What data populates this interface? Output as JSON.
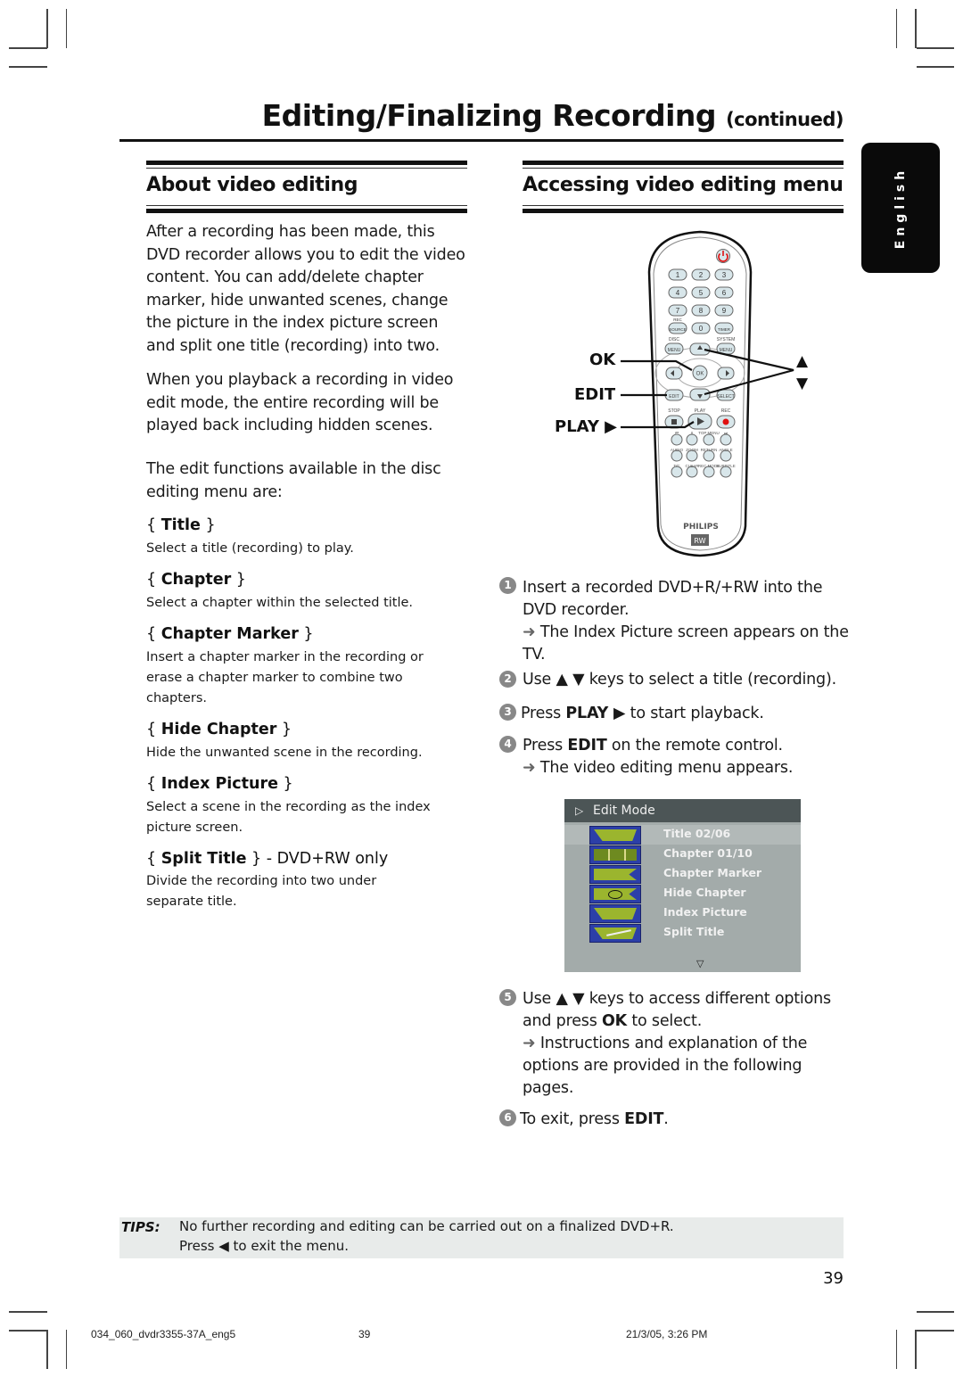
{
  "header": {
    "title": "Editing/Finalizing Recording",
    "title_suffix": "(continued)"
  },
  "language_tab": "English",
  "left_section": {
    "heading": "About video editing",
    "paragraphs": [
      "After a recording has been made, this DVD recorder allows you to edit the video content. You can add/delete chapter marker, hide unwanted scenes, change the picture in the index picture screen and split one title (recording) into two.",
      "When you playback a recording in video edit mode, the entire recording will be played back including hidden scenes.",
      "The edit functions available in the disc editing menu are:"
    ],
    "options": [
      {
        "name": "Title",
        "suffix": "",
        "description": "Select a title (recording) to play."
      },
      {
        "name": "Chapter",
        "suffix": "",
        "description": "Select a chapter within the selected title."
      },
      {
        "name": "Chapter Marker",
        "suffix": "",
        "description": "Insert a chapter marker in the recording or erase a chapter marker to combine two chapters."
      },
      {
        "name": "Hide Chapter",
        "suffix": "",
        "description": "Hide the unwanted scene in the recording."
      },
      {
        "name": "Index Picture",
        "suffix": "",
        "description": "Select a scene in the recording as the index picture screen."
      },
      {
        "name": "Split Title",
        "suffix": " - DVD+RW only",
        "description": "Divide the recording into two under separate title."
      }
    ]
  },
  "right_section": {
    "heading": "Accessing video editing menu",
    "remote": {
      "labels": {
        "ok": "OK",
        "edit": "EDIT",
        "play": "PLAY ▶",
        "up": "▲",
        "down": "▼"
      },
      "brand": "PHILIPS",
      "logo": "RW",
      "keys": {
        "digits": [
          "1",
          "2",
          "3",
          "4",
          "5",
          "6",
          "7",
          "8",
          "9",
          "0"
        ],
        "rec_source": "SOURCE",
        "timer": "TIMER",
        "rec_label": "REC",
        "disc_menu_label": "DISC",
        "menu": "MENU",
        "system_label": "SYSTEM",
        "ok": "OK",
        "edit": "EDIT",
        "select": "SELECT",
        "stop": "STOP",
        "play": "PLAY",
        "rec": "REC",
        "row1": [
          "⏮",
          "⏸",
          "TOP MENU",
          "⏭"
        ],
        "row2": [
          "AUDIO",
          "ZOOM",
          "RETURN",
          "ANGLE"
        ],
        "row3": [
          "T/C",
          "CLEAR",
          "REC MODE",
          "SUBTITLE"
        ]
      }
    },
    "steps": [
      {
        "n": "1",
        "text": "Insert a recorded DVD+R/+RW into the DVD recorder.",
        "result": "The Index Picture screen appears on the TV."
      },
      {
        "n": "2",
        "pre": "Use ▲ ▼ keys to select a title (recording).",
        "text": "Use ▲ ▼ keys to select a title (recording)."
      },
      {
        "n": "3",
        "pre": "Press ",
        "bold": "PLAY ▶",
        "post": " to start playback."
      },
      {
        "n": "4",
        "pre": "Press ",
        "bold": "EDIT",
        "post": " on the remote control.",
        "result": "The video editing menu appears."
      },
      {
        "n": "5",
        "pre": "Use ▲ ▼ keys to access different options and press ",
        "bold": "OK",
        "post": " to select.",
        "result": "Instructions and explanation of the options are provided in the following pages."
      },
      {
        "n": "6",
        "pre": "To exit, press ",
        "bold": "EDIT",
        "post": "."
      }
    ],
    "result_arrow": "➜",
    "edit_menu": {
      "header": "Edit Mode",
      "header_icon": "▷",
      "items": [
        {
          "label": "Title 02/06",
          "icon": "title-folder-icon",
          "selected": true
        },
        {
          "label": "Chapter 01/10",
          "icon": "chapter-icon",
          "selected": false
        },
        {
          "label": "Chapter Marker",
          "icon": "chapter-marker-icon",
          "selected": false
        },
        {
          "label": "Hide Chapter",
          "icon": "hide-chapter-eye-icon",
          "selected": false
        },
        {
          "label": "Index Picture",
          "icon": "index-picture-icon",
          "selected": false
        },
        {
          "label": "Split Title",
          "icon": "split-title-scissors-icon",
          "selected": false
        }
      ],
      "more_indicator": "▽"
    }
  },
  "tips": {
    "label": "TIPS:",
    "lines": [
      "No further recording and editing can be carried out on a finalized DVD+R.",
      "Press ◀ to exit the menu."
    ]
  },
  "page_number": "39",
  "footer": {
    "file": "034_060_dvdr3355-37A_eng5",
    "page": "39",
    "timestamp": "21/3/05, 3:26 PM"
  },
  "colors": {
    "menu_header": "#4c5556",
    "menu_body": "#a3abaa",
    "menu_icon_bg": "#2c3fa8",
    "menu_icon_fg": "#9bb52e",
    "tips_bg": "#e8ebea",
    "rec_red": "#e01010"
  }
}
